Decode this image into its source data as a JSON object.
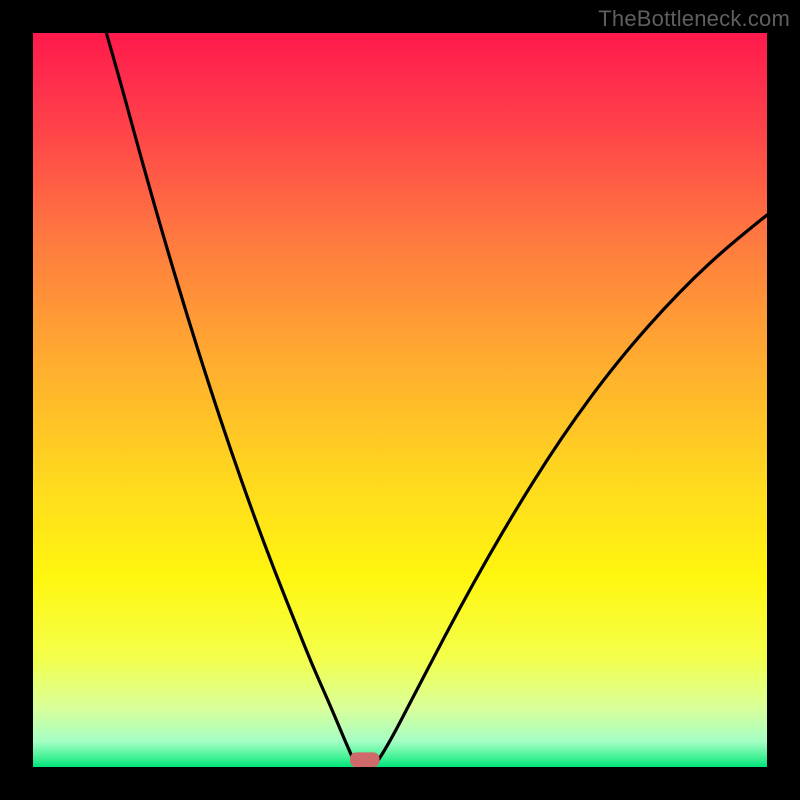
{
  "watermark": "TheBottleneck.com",
  "chart_data": {
    "type": "line",
    "title": "",
    "xlabel": "",
    "ylabel": "",
    "xlim": [
      0,
      100
    ],
    "ylim": [
      0,
      100
    ],
    "background": {
      "type": "vertical-gradient",
      "stops": [
        {
          "pos": 0.0,
          "color": "#ff1a4d"
        },
        {
          "pos": 0.12,
          "color": "#ff3f4a"
        },
        {
          "pos": 0.28,
          "color": "#ff7940"
        },
        {
          "pos": 0.45,
          "color": "#ffad2f"
        },
        {
          "pos": 0.6,
          "color": "#ffd61f"
        },
        {
          "pos": 0.74,
          "color": "#fff60f"
        },
        {
          "pos": 0.85,
          "color": "#f4ff4a"
        },
        {
          "pos": 0.92,
          "color": "#d9ff9a"
        },
        {
          "pos": 0.965,
          "color": "#a5ffc4"
        },
        {
          "pos": 0.985,
          "color": "#4cf39a"
        },
        {
          "pos": 1.0,
          "color": "#00e47a"
        }
      ]
    },
    "series": [
      {
        "name": "left-branch",
        "stroke": "#000000",
        "points": [
          {
            "x": 10.0,
            "y": 100.0
          },
          {
            "x": 12.0,
            "y": 93.0
          },
          {
            "x": 15.0,
            "y": 82.0
          },
          {
            "x": 18.0,
            "y": 71.5
          },
          {
            "x": 21.0,
            "y": 61.5
          },
          {
            "x": 24.0,
            "y": 52.0
          },
          {
            "x": 27.0,
            "y": 43.0
          },
          {
            "x": 30.0,
            "y": 34.5
          },
          {
            "x": 33.0,
            "y": 26.5
          },
          {
            "x": 36.0,
            "y": 19.0
          },
          {
            "x": 38.0,
            "y": 14.0
          },
          {
            "x": 40.0,
            "y": 9.5
          },
          {
            "x": 41.5,
            "y": 6.0
          },
          {
            "x": 42.5,
            "y": 3.6
          },
          {
            "x": 43.3,
            "y": 1.8
          },
          {
            "x": 43.8,
            "y": 0.6
          },
          {
            "x": 44.3,
            "y": 0.0
          }
        ]
      },
      {
        "name": "right-branch",
        "stroke": "#000000",
        "points": [
          {
            "x": 46.2,
            "y": 0.0
          },
          {
            "x": 46.7,
            "y": 0.5
          },
          {
            "x": 47.5,
            "y": 1.6
          },
          {
            "x": 49.0,
            "y": 4.2
          },
          {
            "x": 51.0,
            "y": 8.0
          },
          {
            "x": 54.0,
            "y": 13.8
          },
          {
            "x": 58.0,
            "y": 21.4
          },
          {
            "x": 62.0,
            "y": 28.6
          },
          {
            "x": 66.0,
            "y": 35.4
          },
          {
            "x": 70.0,
            "y": 41.8
          },
          {
            "x": 74.0,
            "y": 47.7
          },
          {
            "x": 78.0,
            "y": 53.1
          },
          {
            "x": 82.0,
            "y": 58.0
          },
          {
            "x": 86.0,
            "y": 62.5
          },
          {
            "x": 90.0,
            "y": 66.6
          },
          {
            "x": 94.0,
            "y": 70.3
          },
          {
            "x": 98.0,
            "y": 73.6
          },
          {
            "x": 100.0,
            "y": 75.2
          }
        ]
      }
    ],
    "marker": {
      "name": "minimum-marker",
      "shape": "rounded-rect",
      "color": "#d06a6a",
      "x_center": 45.2,
      "y_center": 1.0,
      "width": 4.0,
      "height": 2.0
    }
  }
}
